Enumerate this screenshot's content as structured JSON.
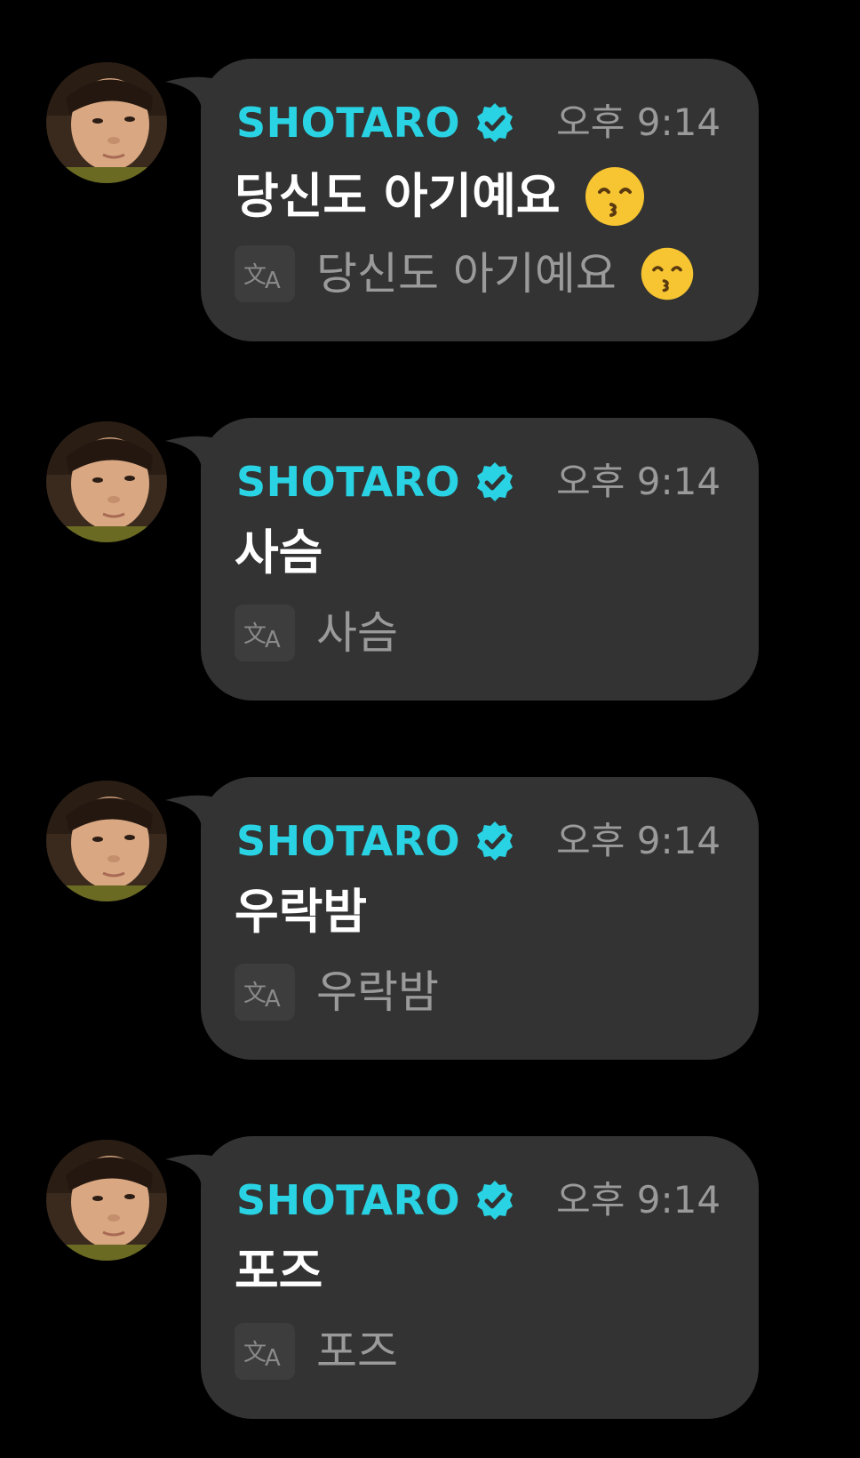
{
  "messages": [
    {
      "author": "SHOTARO",
      "time": "오후 9:14",
      "text": "당신도 아기예요",
      "text_emoji": "kissing-smiling-eyes-emoji",
      "translation": "당신도 아기예요",
      "translation_emoji": "kissing-smiling-eyes-emoji"
    },
    {
      "author": "SHOTARO",
      "time": "오후 9:14",
      "text": "사슴",
      "translation": "사슴"
    },
    {
      "author": "SHOTARO",
      "time": "오후 9:14",
      "text": "우락밤",
      "translation": "우락밤"
    },
    {
      "author": "SHOTARO",
      "time": "오후 9:14",
      "text": "포즈",
      "translation": "포즈"
    }
  ],
  "icons": {
    "verified": "verified-badge-icon",
    "translate": "translate-icon",
    "avatar": "baby-photo-avatar"
  },
  "colors": {
    "background": "#000000",
    "bubble": "#333333",
    "name": "#29d3e3",
    "badge": "#29d3e3",
    "time": "#9a9a9a",
    "text": "#ffffff",
    "translation": "#9a9a9a",
    "translate_icon_bg": "#3d3d3d"
  }
}
